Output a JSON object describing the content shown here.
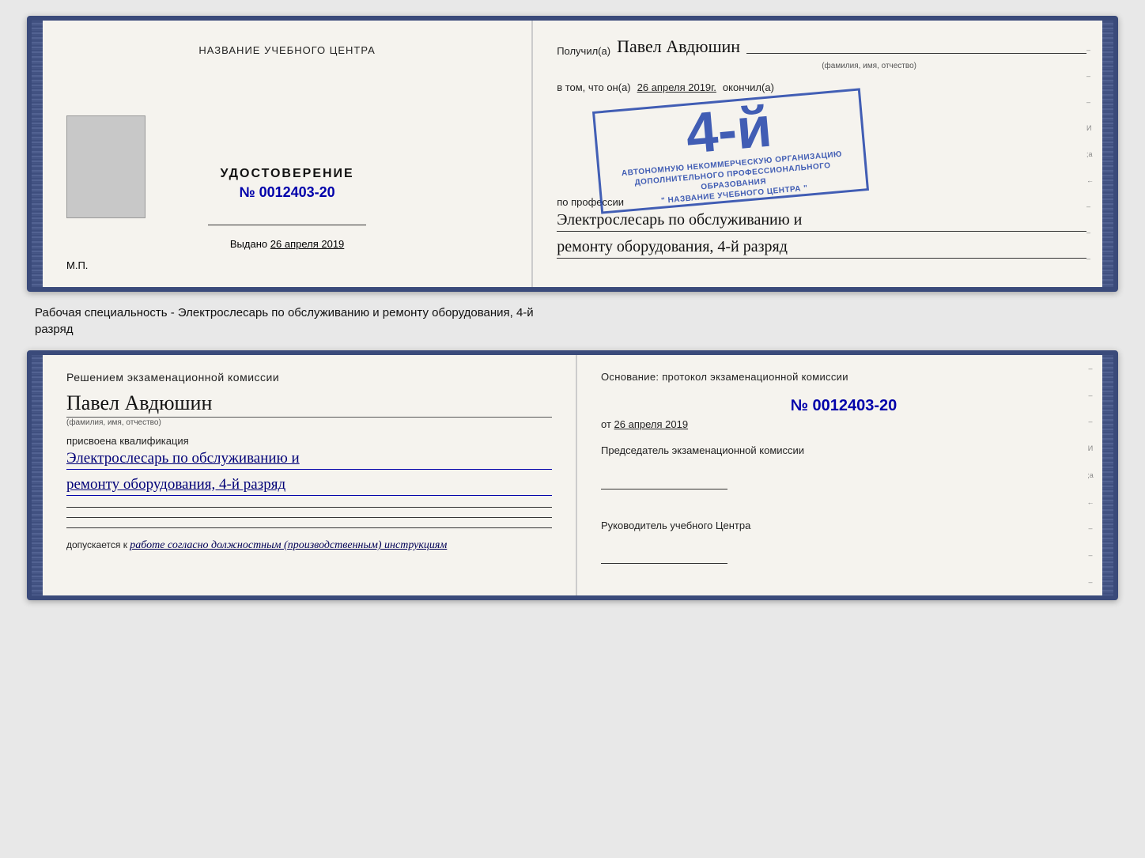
{
  "top_booklet": {
    "left": {
      "header": "НАЗВАНИЕ УЧЕБНОГО ЦЕНТРА",
      "photo_alt": "photo",
      "cert_title": "УДОСТОВЕРЕНИЕ",
      "cert_number_label": "№",
      "cert_number": "0012403-20",
      "issued_label": "Выдано",
      "issued_date": "26 апреля 2019",
      "mp_label": "М.П."
    },
    "right": {
      "received_label": "Получил(а)",
      "person_name": "Павел Авдюшин",
      "person_sub": "(фамилия, имя, отчество)",
      "vtom_label": "в том, что он(а)",
      "vtom_date": "26 апреля 2019г.",
      "okonchill_label": "окончил(а)",
      "stamp_number": "4-й",
      "stamp_line1": "АВТОНОМНУЮ НЕКОММЕРЧЕСКУЮ ОРГАНИЗАЦИЮ",
      "stamp_line2": "ДОПОЛНИТЕЛЬНОГО ПРОФЕССИОНАЛЬНОГО ОБРАЗОВАНИЯ",
      "stamp_line3": "\" НАЗВАНИЕ УЧЕБНОГО ЦЕНТРА \"",
      "po_professii_label": "по профессии",
      "profession_line1": "Электрослесарь по обслуживанию и",
      "profession_line2": "ремонту оборудования, 4-й разряд"
    }
  },
  "mid_text": {
    "line1": "Рабочая специальность - Электрослесарь по обслуживанию и ремонту оборудования, 4-й",
    "line2": "разряд"
  },
  "bottom_booklet": {
    "left": {
      "title": "Решением экзаменационной комиссии",
      "person_name": "Павел Авдюшин",
      "person_sub": "(фамилия, имя, отчество)",
      "prisvoena_label": "присвоена квалификация",
      "qual_line1": "Электрослесарь по обслуживанию и",
      "qual_line2": "ремонту оборудования, 4-й разряд",
      "dopusk_prefix": "допускается к",
      "dopusk_text": "работе согласно должностным (производственным) инструкциям"
    },
    "right": {
      "osnov_label": "Основание: протокол экзаменационной комиссии",
      "number_label": "№",
      "number": "0012403-20",
      "ot_label": "от",
      "ot_date": "26 апреля 2019",
      "predsedatel_label": "Председатель экзаменационной комиссии",
      "ruk_label": "Руководитель учебного Центра"
    },
    "right_edge": [
      "–",
      "–",
      "–",
      "И",
      ";а",
      "←",
      "–",
      "–",
      "–"
    ]
  },
  "top_right_edge": [
    "–",
    "–",
    "–",
    "И",
    ";а",
    "←",
    "–",
    "–",
    "–"
  ]
}
